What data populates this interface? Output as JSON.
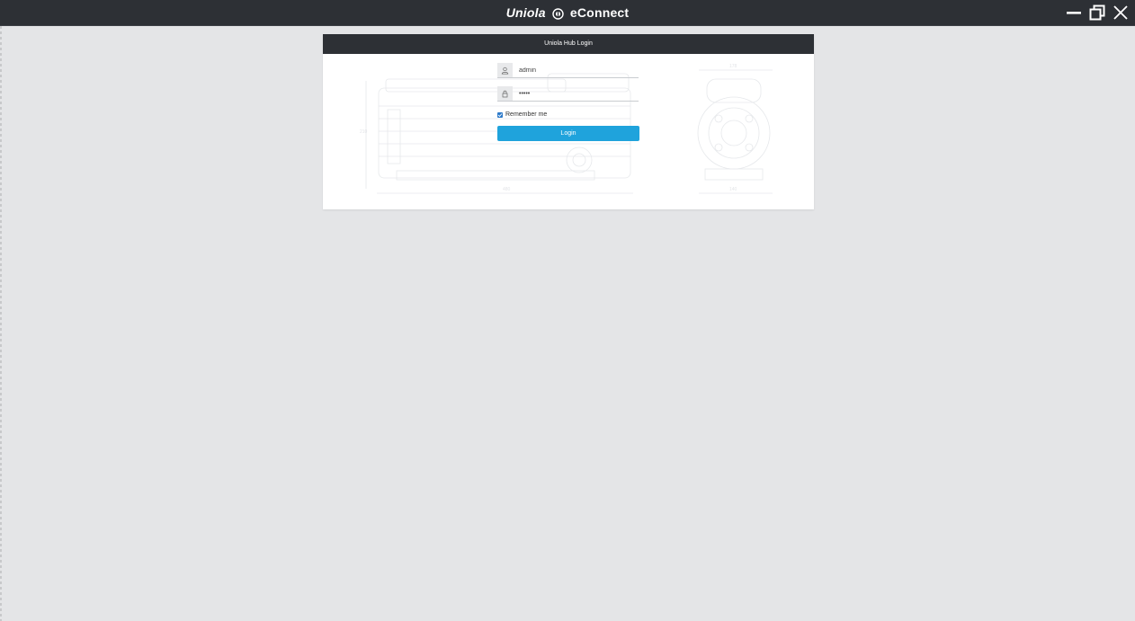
{
  "titlebar": {
    "brand_name": "Uniola",
    "product_name": "eConnect",
    "controls": {
      "minimize_icon": "minimize-icon",
      "restore_icon": "restore-icon",
      "close_icon": "close-icon"
    }
  },
  "login": {
    "title": "Uniola Hub Login",
    "username": {
      "icon": "user-icon",
      "value": "admin"
    },
    "password": {
      "icon": "lock-icon",
      "value": "•••••"
    },
    "remember_me": {
      "label": "Remember me",
      "checked": true
    },
    "login_button": "Login"
  },
  "drawing_labels": {
    "side_width": "480",
    "side_height": "210",
    "front_top": "178",
    "front_bottom": "140"
  },
  "colors": {
    "titlebar_bg": "#2d3035",
    "page_bg": "#e4e5e7",
    "button": "#1fa3dc",
    "checkbox": "#2b79c9"
  }
}
